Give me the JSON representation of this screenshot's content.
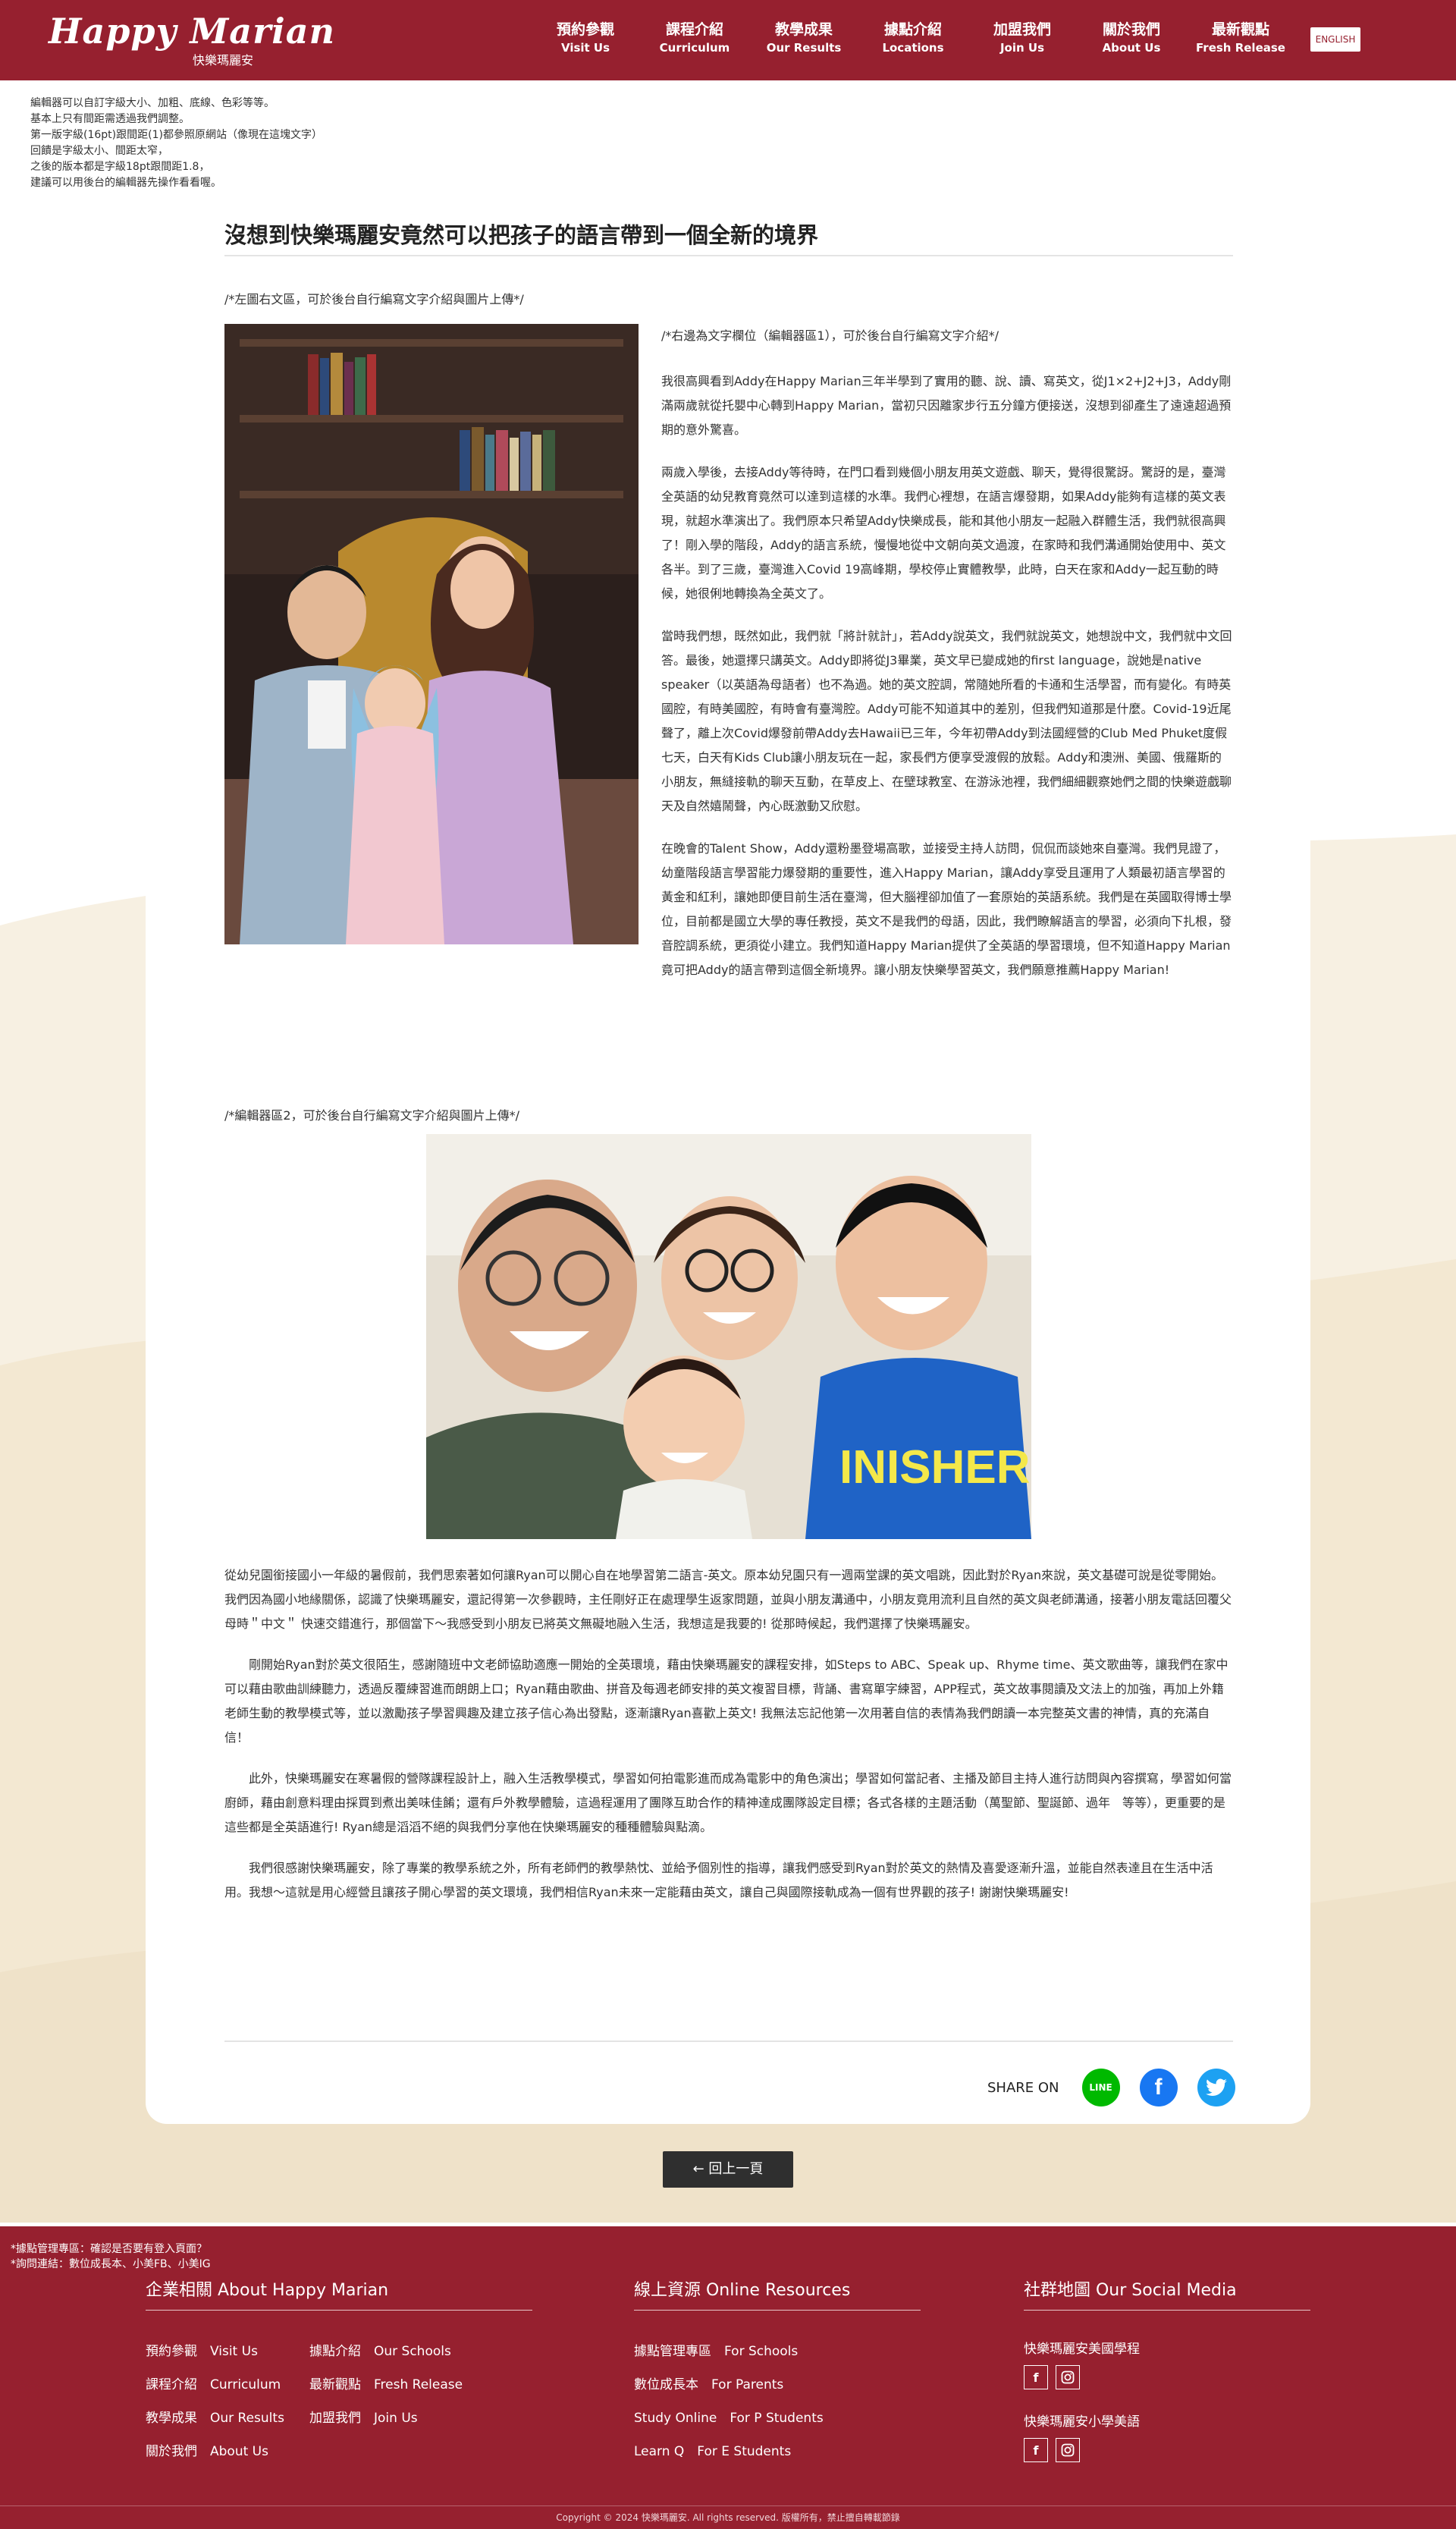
{
  "colors": {
    "brand": "#96202f",
    "cream": "#f6efe0",
    "line": "#00b900",
    "facebook": "#1877f2",
    "twitter": "#1da1f2"
  },
  "header": {
    "logo_text": "Happy Marian",
    "logo_sub": "快樂瑪麗安",
    "nav": [
      {
        "zh": "預約參觀",
        "en": "Visit Us"
      },
      {
        "zh": "課程介紹",
        "en": "Curriculum"
      },
      {
        "zh": "教學成果",
        "en": "Our Results"
      },
      {
        "zh": "據點介紹",
        "en": "Locations"
      },
      {
        "zh": "加盟我們",
        "en": "Join Us"
      },
      {
        "zh": "關於我們",
        "en": "About Us"
      },
      {
        "zh": "最新觀點",
        "en": "Fresh Release"
      }
    ],
    "lang_button": "ENGLISH"
  },
  "editor_notes": [
    "編輯器可以自訂字級大小、加粗、底線、色彩等等。",
    "基本上只有間距需透過我們調整。",
    "第一版字級(16pt)跟間距(1)都參照原網站（像現在這塊文字）",
    "回饋是字級太小、間距太窄，",
    "之後的版本都是字級18pt跟間距1.8，",
    "建議可以用後台的編輯器先操作看看喔。"
  ],
  "article": {
    "title": "沒想到快樂瑪麗安竟然可以把孩子的語言帶到一個全新的境界",
    "left_hint": "/*左圖右文區，可於後台自行編寫文字介紹與圖片上傳*/",
    "right_hint": "/*右邊為文字欄位（編輯器區1），可於後台自行編寫文字介紹*/",
    "right_paragraphs": [
      "我很高興看到Addy在Happy Marian三年半學到了實用的聽、說、讀、寫英文，從J1×2+J2+J3，Addy剛滿兩歲就從托嬰中心轉到Happy Marian，當初只因離家步行五分鐘方便接送，沒想到卻產生了遠遠超過預期的意外驚喜。",
      "兩歲入學後，去接Addy等待時，在門口看到幾個小朋友用英文遊戲、聊天，覺得很驚訝。驚訝的是，臺灣全英語的幼兒教育竟然可以達到這樣的水準。我們心裡想，在語言爆發期，如果Addy能夠有這樣的英文表現，就超水準演出了。我們原本只希望Addy快樂成長，能和其他小朋友一起融入群體生活，我們就很高興了！剛入學的階段，Addy的語言系統，慢慢地從中文朝向英文過渡，在家時和我們溝通開始使用中、英文各半。到了三歲，臺灣進入Covid 19高峰期，學校停止實體教學，此時，白天在家和Addy一起互動的時候，她很俐地轉換為全英文了。",
      "當時我們想，既然如此，我們就「將計就計」，若Addy說英文，我們就說英文，她想說中文，我們就中文回答。最後，她還擇只講英文。Addy即將從J3畢業，英文早已變成她的first language，說她是native speaker（以英語為母語者）也不為過。她的英文腔調，常隨她所看的卡通和生活學習，而有變化。有時英國腔，有時美國腔，有時會有臺灣腔。Addy可能不知道其中的差別，但我們知道那是什麼。Covid-19近尾聲了，離上次Covid爆發前帶Addy去Hawaii已三年，今年初帶Addy到法國經營的Club Med Phuket度假七天，白天有Kids Club讓小朋友玩在一起，家長們方便享受渡假的放鬆。Addy和澳洲、美國、俄羅斯的小朋友，無縫接軌的聊天互動，在草皮上、在壁球教室、在游泳池裡，我們細細觀察她們之間的快樂遊戲聊天及自然嬉鬧聲，內心既激動又欣慰。",
      "在晚會的Talent Show，Addy還粉墨登場高歌，並接受主持人訪問，侃侃而談她來自臺灣。我們見證了，幼童階段語言學習能力爆發期的重要性，進入Happy Marian，讓Addy享受且運用了人類最初語言學習的黃金和紅利，讓她即便目前生活在臺灣，但大腦裡卻加值了一套原始的英語系統。我們是在英國取得博士學位，目前都是國立大學的專任教授，英文不是我們的母語，因此，我們瞭解語言的學習，必須向下扎根，發音腔調系統，更須從小建立。我們知道Happy Marian提供了全英語的學習環境，但不知道Happy Marian竟可把Addy的語言帶到這個全新境界。讓小朋友快樂學習英文，我們願意推薦Happy Marian!"
    ],
    "editor2_hint": "/*編輯器區2，可於後台自行編寫文字介紹與圖片上傳*/",
    "body_paragraphs": [
      "從幼兒園銜接國小一年級的暑假前，我們思索著如何讓Ryan可以開心自在地學習第二語言-英文。原本幼兒園只有一週兩堂課的英文唱跳，因此對於Ryan來說，英文基礎可說是從零開始。我們因為國小地緣關係，認識了快樂瑪麗安，還記得第一次參觀時，主任剛好正在處理學生返家問題，並與小朋友溝通中，小朋友竟用流利且自然的英文與老師溝通，接著小朋友電話回覆父母時＂中文＂ 快速交錯進行，那個當下～我感受到小朋友已將英文無礙地融入生活，我想這是我要的! 從那時候起，我們選擇了快樂瑪麗安。",
      "剛開始Ryan對於英文很陌生，感謝隨班中文老師協助適應一開始的全英環境，藉由快樂瑪麗安的課程安排，如Steps to ABC、Speak up、Rhyme time、英文歌曲等，讓我們在家中可以藉由歌曲訓練聽力，透過反覆練習進而朗朗上口；Ryan藉由歌曲、拼音及每週老師安排的英文複習目標，背誦、書寫單字練習，APP程式，英文故事閱讀及文法上的加強，再加上外籍老師生動的教學模式等，並以激勵孩子學習興趣及建立孩子信心為出發點，逐漸讓Ryan喜歡上英文! 我無法忘記他第一次用著自信的表情為我們朗讀一本完整英文書的神情，真的充滿自信！",
      "此外，快樂瑪麗安在寒暑假的營隊課程設計上，融入生活教學模式，學習如何拍電影進而成為電影中的角色演出；學習如何當記者、主播及節目主持人進行訪問與內容撰寫，學習如何當廚師，藉由創意料理由採買到煮出美味佳餚；還有戶外教學體驗，這過程運用了團隊互助合作的精神達成團隊設定目標；各式各樣的主題活動（萬聖節、聖誕節、過年　等等），更重要的是這些都是全英語進行! Ryan總是滔滔不絕的與我們分享他在快樂瑪麗安的種種體驗與點滴。",
      "我們很感謝快樂瑪麗安，除了專業的教學系統之外，所有老師們的教學熱忱、並給予個別性的指導，讓我們感受到Ryan對於英文的熱情及喜愛逐漸升溫，並能自然表達且在生活中活用。我想～這就是用心經營且讓孩子開心學習的英文環境，我們相信Ryan未來一定能藉由英文，讓自己與國際接軌成為一個有世界觀的孩子! 謝謝快樂瑪麗安!"
    ],
    "share_label": "SHARE ON",
    "share_icons": [
      "line-icon",
      "facebook-icon",
      "twitter-icon"
    ]
  },
  "back_button": "← 回上一頁",
  "footer": {
    "notes": [
      "*據點管理專區：確認是否要有登入頁面？",
      "*詢問連結：數位成長本、小美FB、小美IG"
    ],
    "col1": {
      "title": "企業相關 About Happy Marian",
      "rows": [
        [
          "預約參觀　Visit Us",
          "據點介紹　Our Schools"
        ],
        [
          "課程介紹　Curriculum",
          "最新觀點　Fresh Release"
        ],
        [
          "教學成果　Our Results",
          "加盟我們　Join Us"
        ],
        [
          "關於我們　About Us",
          ""
        ]
      ]
    },
    "col2": {
      "title": "線上資源 Online Resources",
      "links": [
        "據點管理專區　For Schools",
        "數位成長本　For Parents",
        "Study Online　For P Students",
        "Learn Q　For E Students"
      ]
    },
    "col3": {
      "title": "社群地圖 Our Social Media",
      "groups": [
        "快樂瑪麗安美國學程",
        "快樂瑪麗安小學美語"
      ]
    },
    "copyright": "Copyright © 2024 快樂瑪麗安. All rights reserved. 版權所有，禁止擅自轉載節錄"
  }
}
